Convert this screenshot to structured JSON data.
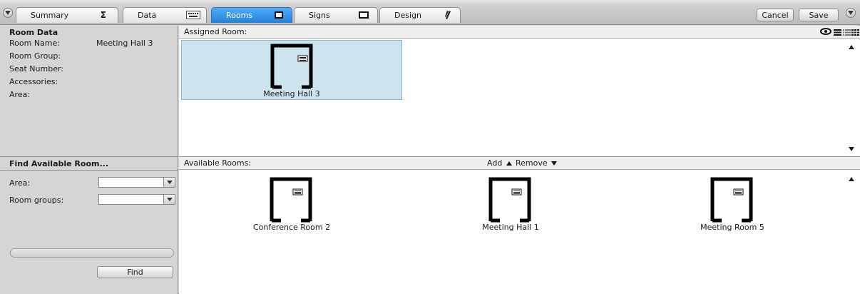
{
  "toolbar": {
    "tabs": [
      {
        "label": "Summary",
        "icon": "sigma-icon",
        "icon_char": "Σ"
      },
      {
        "label": "Data",
        "icon": "keyboard-icon"
      },
      {
        "label": "Rooms",
        "icon": "room-icon"
      },
      {
        "label": "Signs",
        "icon": "sign-icon"
      },
      {
        "label": "Design",
        "icon": "pen-icon"
      }
    ],
    "cancel_label": "Cancel",
    "save_label": "Save",
    "accent": "#2e8ae6"
  },
  "room_data": {
    "title": "Room Data",
    "fields": [
      {
        "label": "Room Name:",
        "value": "Meeting Hall 3"
      },
      {
        "label": "Room Group:",
        "value": ""
      },
      {
        "label": "Seat Number:",
        "value": ""
      },
      {
        "label": "Accessories:",
        "value": ""
      },
      {
        "label": "Area:",
        "value": ""
      }
    ]
  },
  "find": {
    "title": "Find Available Room...",
    "area_label": "Area:",
    "area_value": "",
    "groups_label": "Room groups:",
    "groups_value": "",
    "button_label": "Find"
  },
  "assigned": {
    "header": "Assigned Room:",
    "rooms": [
      {
        "name": "Meeting Hall 3"
      }
    ]
  },
  "available": {
    "header": "Available Rooms:",
    "add_label": "Add",
    "remove_label": "Remove",
    "rooms": [
      {
        "name": "Conference Room 2"
      },
      {
        "name": "Meeting Hall 1"
      },
      {
        "name": "Meeting Room 5"
      }
    ]
  }
}
